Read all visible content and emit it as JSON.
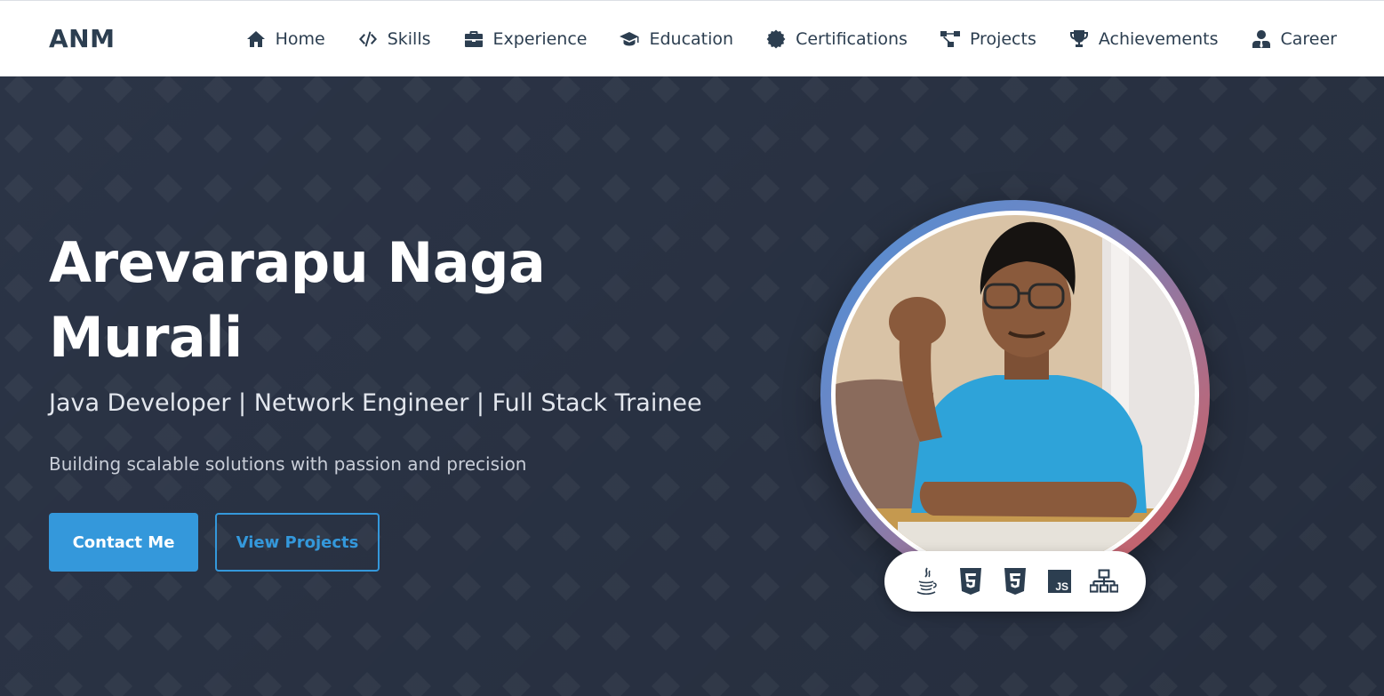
{
  "brand": "ANM",
  "nav": {
    "items": [
      {
        "label": "Home",
        "icon": "home-icon"
      },
      {
        "label": "Skills",
        "icon": "code-icon"
      },
      {
        "label": "Experience",
        "icon": "briefcase-icon"
      },
      {
        "label": "Education",
        "icon": "graduation-cap-icon"
      },
      {
        "label": "Certifications",
        "icon": "certificate-icon"
      },
      {
        "label": "Projects",
        "icon": "project-diagram-icon"
      },
      {
        "label": "Achievements",
        "icon": "trophy-icon"
      },
      {
        "label": "Career",
        "icon": "user-tie-icon"
      }
    ]
  },
  "hero": {
    "name": "Arevarapu Naga Murali",
    "subtitle": "Java Developer | Network Engineer | Full Stack Trainee",
    "tagline": "Building scalable solutions with passion and precision",
    "primary_button": "Contact Me",
    "secondary_button": "View Projects"
  },
  "profile": {
    "tech_icons": [
      "java-icon",
      "html5-icon",
      "css3-icon",
      "js-icon",
      "network-icon"
    ],
    "tech_js_text": "JS"
  },
  "colors": {
    "accent": "#3498db",
    "nav_text": "#2c3e50",
    "hero_bg": "#2b3446"
  }
}
